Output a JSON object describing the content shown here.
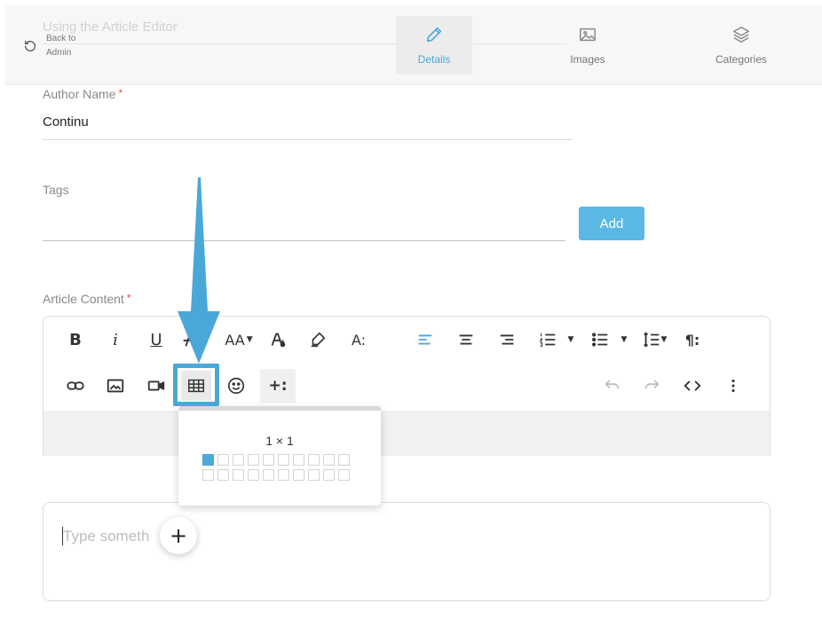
{
  "header": {
    "page_title": "Using the Article Editor",
    "back_label": "Back to Admin",
    "tabs": [
      {
        "label": "Details",
        "icon": "pencil-icon",
        "active": true
      },
      {
        "label": "Images",
        "icon": "image-icon",
        "active": false
      },
      {
        "label": "Categories",
        "icon": "layers-icon",
        "active": false
      }
    ]
  },
  "form": {
    "author_label": "Author Name",
    "author_value": "Continu",
    "required_mark": "*",
    "tags_label": "Tags",
    "add_label": "Add",
    "content_label": "Article Content"
  },
  "toolbar": {
    "bold": "B",
    "italic": "i",
    "underline": "U",
    "font_size": "AA",
    "text_style": "A:",
    "paragraph": "¶:",
    "insert_more": "+:"
  },
  "editor": {
    "placeholder": "Type someth",
    "float_plus": "+"
  },
  "table_picker": {
    "size_label": "1 × 1",
    "rows": 2,
    "cols": 10,
    "selected": 1
  },
  "colors": {
    "accent": "#4aa8d8",
    "add_button": "#5bb8e4",
    "required": "#e74c3c"
  }
}
